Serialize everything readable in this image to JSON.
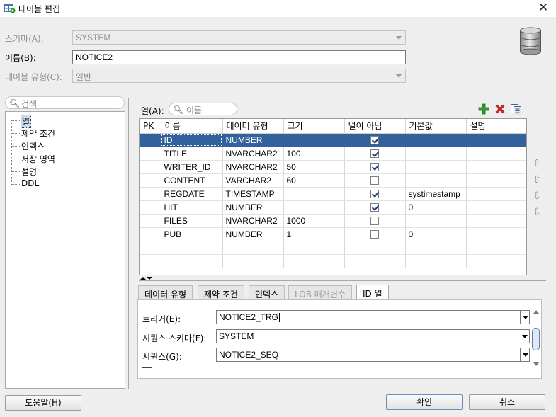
{
  "window": {
    "title": "테이블 편집",
    "close_glyph": "✕"
  },
  "form": {
    "schema": {
      "label": "스키마(A):",
      "value": "SYSTEM"
    },
    "name": {
      "label": "이름(B):",
      "value": "NOTICE2"
    },
    "table_type": {
      "label": "테이블 유형(C):",
      "value": "일반"
    }
  },
  "left": {
    "search_placeholder": "검색",
    "items": [
      "열",
      "제약 조건",
      "인덱스",
      "저장 영역",
      "설명",
      "DDL"
    ]
  },
  "columns_panel": {
    "label": "열(A):",
    "search_placeholder": "이름",
    "headers": [
      "PK",
      "이름",
      "데이터 유형",
      "크기",
      "널이 아님",
      "기본값",
      "설명"
    ],
    "rows": [
      {
        "pk": "",
        "name": "ID",
        "type": "NUMBER",
        "size": "",
        "not_null": true,
        "default": "",
        "desc": ""
      },
      {
        "pk": "",
        "name": "TITLE",
        "type": "NVARCHAR2",
        "size": "100",
        "not_null": true,
        "default": "",
        "desc": ""
      },
      {
        "pk": "",
        "name": "WRITER_ID",
        "type": "NVARCHAR2",
        "size": "50",
        "not_null": true,
        "default": "",
        "desc": ""
      },
      {
        "pk": "",
        "name": "CONTENT",
        "type": "VARCHAR2",
        "size": "60",
        "not_null": false,
        "default": "",
        "desc": ""
      },
      {
        "pk": "",
        "name": "REGDATE",
        "type": "TIMESTAMP",
        "size": "",
        "not_null": true,
        "default": "systimestamp",
        "desc": ""
      },
      {
        "pk": "",
        "name": "HIT",
        "type": "NUMBER",
        "size": "",
        "not_null": true,
        "default": "0",
        "desc": ""
      },
      {
        "pk": "",
        "name": "FILES",
        "type": "NVARCHAR2",
        "size": "1000",
        "not_null": false,
        "default": "",
        "desc": ""
      },
      {
        "pk": "",
        "name": "PUB",
        "type": "NUMBER",
        "size": "1",
        "not_null": false,
        "default": "0",
        "desc": ""
      }
    ]
  },
  "tabs": [
    "데이터 유형",
    "제약 조건",
    "인덱스",
    "LOB 매개변수",
    "ID 열"
  ],
  "identity": {
    "trigger": {
      "label": "트리거(E):",
      "value": "NOTICE2_TRG"
    },
    "seq_schema": {
      "label": "시퀀스 스키마(F):",
      "value": "SYSTEM"
    },
    "sequence": {
      "label": "시퀀스(G):",
      "value": "NOTICE2_SEQ"
    }
  },
  "buttons": {
    "help": "도움말(H)",
    "ok": "확인",
    "cancel": "취소"
  },
  "colors": {
    "selection": "#33619c",
    "add": "#2e9d2e",
    "delete": "#d8261f"
  }
}
